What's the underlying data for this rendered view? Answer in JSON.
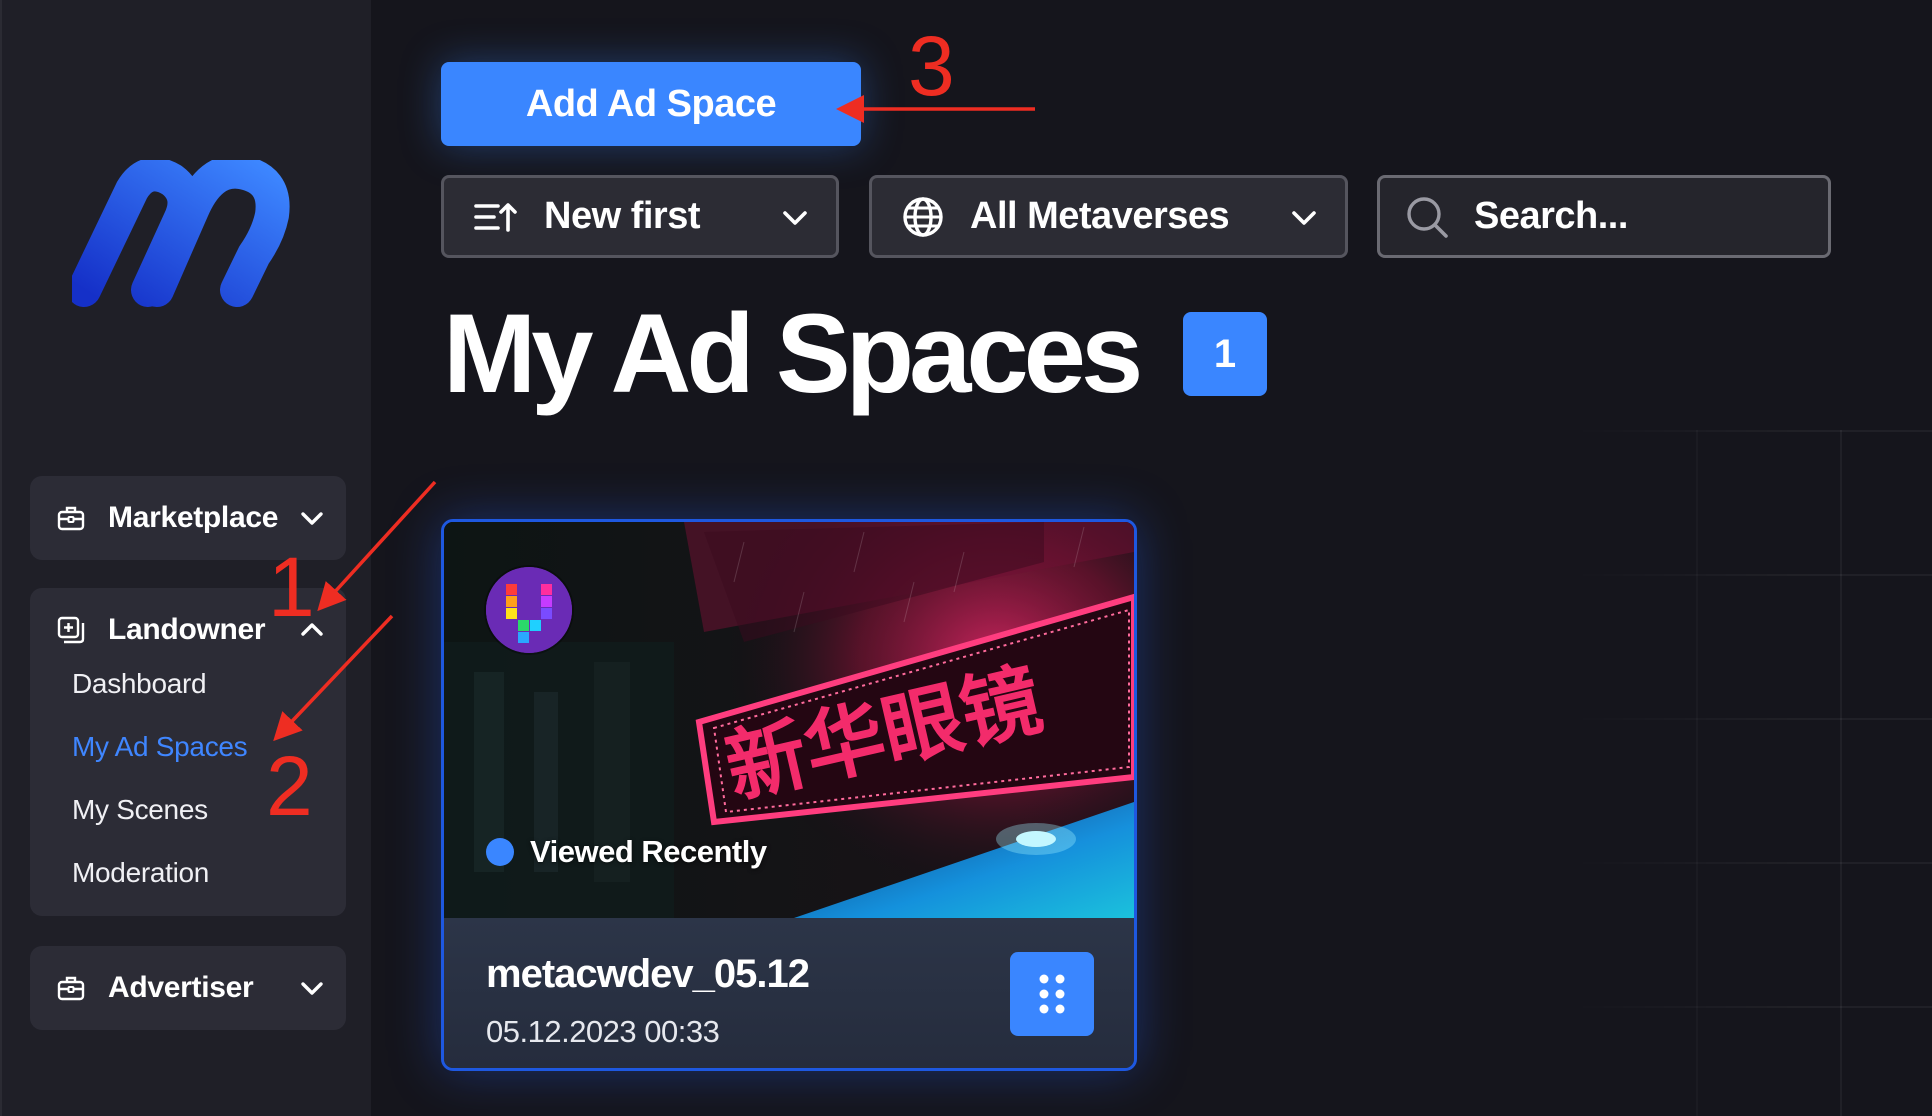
{
  "sidebar": {
    "logo_icon": "metaverse-m-logo",
    "groups": [
      {
        "label": "Marketplace",
        "icon": "briefcase-icon",
        "expanded": false
      },
      {
        "label": "Landowner",
        "icon": "add-square-icon",
        "expanded": true,
        "items": [
          {
            "label": "Dashboard",
            "active": false
          },
          {
            "label": "My Ad Spaces",
            "active": true
          },
          {
            "label": "My Scenes",
            "active": false
          },
          {
            "label": "Moderation",
            "active": false
          }
        ]
      },
      {
        "label": "Advertiser",
        "icon": "briefcase-icon",
        "expanded": false
      }
    ]
  },
  "toolbar": {
    "add_button_label": "Add Ad Space",
    "sort_label": "New first",
    "metaverse_label": "All Metaverses",
    "search_placeholder": "Search..."
  },
  "page": {
    "title": "My Ad Spaces",
    "count": "1"
  },
  "cards": [
    {
      "name": "metacwdev_05.12",
      "date": "05.12.2023 00:33",
      "status": "Viewed Recently",
      "image_sign_text": "新华眼镜"
    }
  ],
  "annotations": [
    "1",
    "2",
    "3"
  ],
  "colors": {
    "accent": "#3a86ff",
    "sidebar_bg": "#1f1f27",
    "main_bg": "#15151c",
    "annotation_red": "#ee2d22"
  }
}
